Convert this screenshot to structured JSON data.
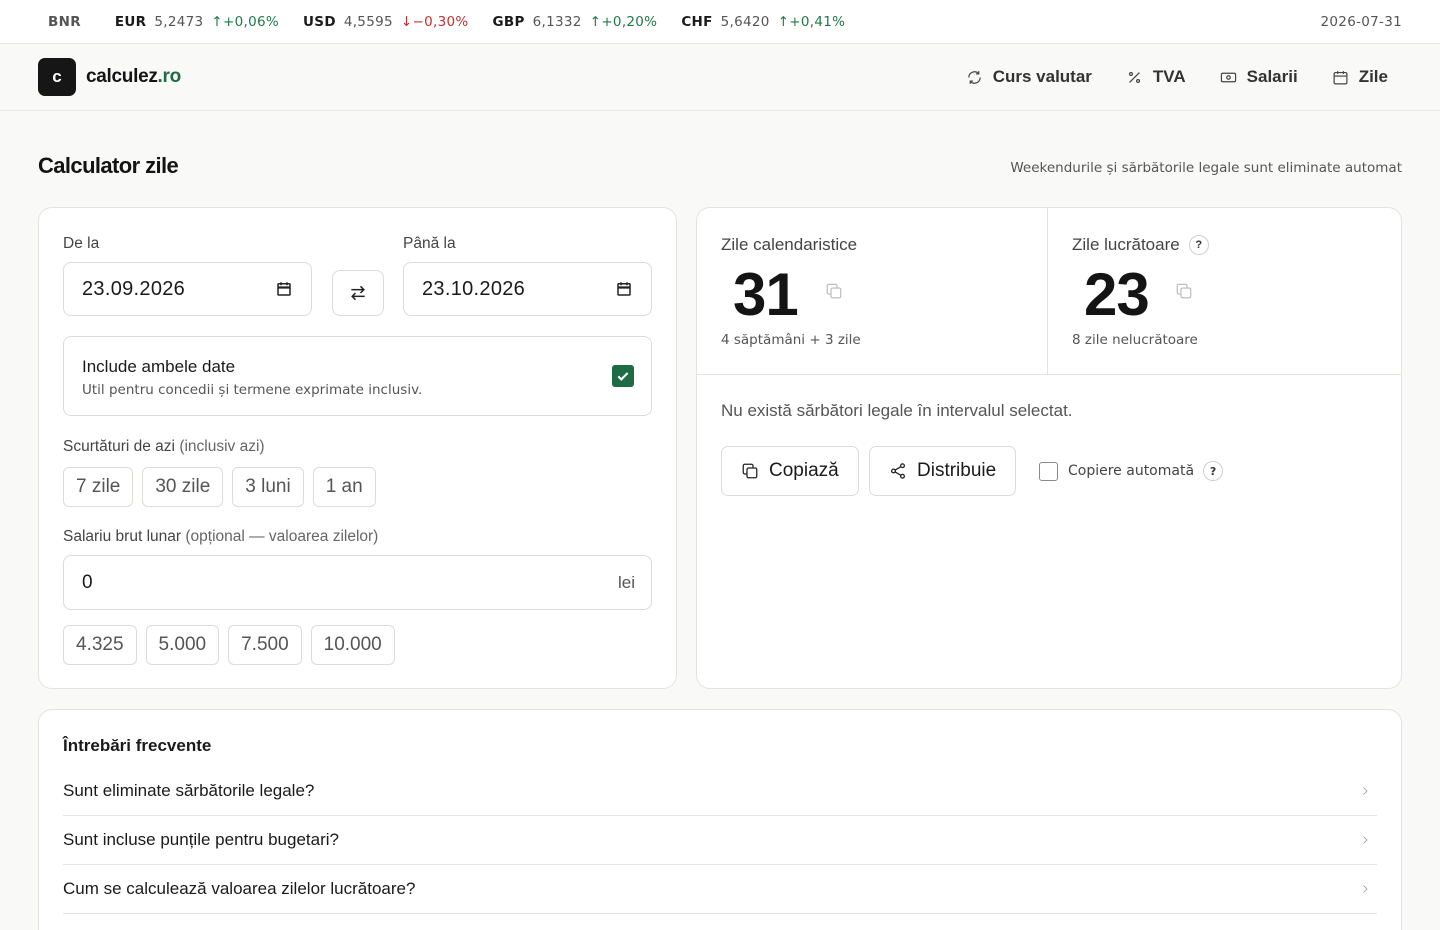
{
  "ticker": {
    "source": "BNR",
    "pairs": [
      {
        "code": "EUR",
        "rate": "5,2473",
        "change": "↑+0,06%",
        "direction": "up"
      },
      {
        "code": "USD",
        "rate": "4,5595",
        "change": "↓−0,30%",
        "direction": "down"
      },
      {
        "code": "GBP",
        "rate": "6,1332",
        "change": "↑+0,20%",
        "direction": "up"
      },
      {
        "code": "CHF",
        "rate": "5,6420",
        "change": "↑+0,41%",
        "direction": "up"
      }
    ],
    "date": "2026-07-31"
  },
  "header": {
    "logo_letter": "c",
    "brand_name": "calculez",
    "brand_tld": ".ro",
    "nav": [
      {
        "label": "Curs valutar",
        "icon": "refresh-icon"
      },
      {
        "label": "TVA",
        "icon": "percent-icon"
      },
      {
        "label": "Salarii",
        "icon": "banknote-icon"
      },
      {
        "label": "Zile",
        "icon": "calendar-icon"
      }
    ]
  },
  "page": {
    "title": "Calculator zile",
    "note": "Weekendurile și sărbătorile legale sunt eliminate automat"
  },
  "form": {
    "from_label": "De la",
    "from_value": "23.09.2026",
    "to_label": "Până la",
    "to_value": "23.10.2026",
    "include_title": "Include ambele date",
    "include_sub": "Util pentru concedii și termene exprimate inclusiv.",
    "include_checked": true,
    "shortcuts_label": "Scurtături de azi",
    "shortcuts_hint": "(inclusiv azi)",
    "shortcuts": [
      "7 zile",
      "30 zile",
      "3 luni",
      "1 an"
    ],
    "salary_label": "Salariu brut lunar",
    "salary_hint": "(opțional — valoarea zilelor)",
    "salary_value": "0",
    "salary_unit": "lei",
    "salary_presets": [
      "4.325",
      "5.000",
      "7.500",
      "10.000"
    ]
  },
  "results": {
    "calendar_label": "Zile calendaristice",
    "calendar_value": "31",
    "calendar_sub": "4 săptămâni + 3 zile",
    "working_label": "Zile lucrătoare",
    "working_help": "?",
    "working_value": "23",
    "working_sub": "8 zile nelucrătoare",
    "no_holidays": "Nu există sărbători legale în intervalul selectat.",
    "copy_label": "Copiază",
    "share_label": "Distribuie",
    "autocopy_label": "Copiere automată",
    "autocopy_help": "?",
    "autocopy_checked": false
  },
  "faq": {
    "title": "Întrebări frecvente",
    "items": [
      "Sunt eliminate sărbătorile legale?",
      "Sunt incluse punțile pentru bugetari?",
      "Cum se calculează valoarea zilelor lucrătoare?"
    ]
  },
  "colors": {
    "accent": "#1f6b45",
    "up": "#1f7a4a",
    "down": "#c53030"
  }
}
